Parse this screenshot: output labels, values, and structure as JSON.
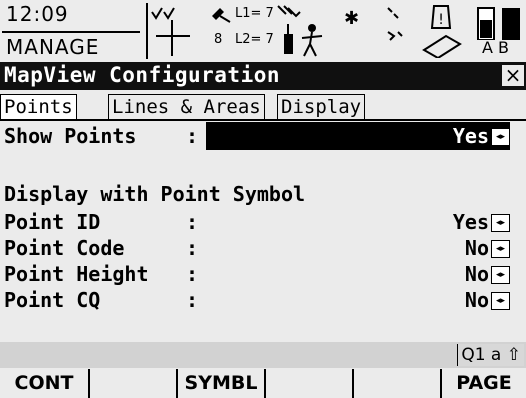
{
  "status": {
    "time": "12:09",
    "mode": "MANAGE",
    "l1_label": "L1= 7",
    "l2_label": "L2= 7",
    "sat_count": "8",
    "ab_label": "A B"
  },
  "window": {
    "title": "MapView Configuration",
    "close_glyph": "×"
  },
  "tabs": [
    {
      "label": "Points",
      "active": true
    },
    {
      "label": "Lines & Areas",
      "active": false
    },
    {
      "label": "Display",
      "active": false
    }
  ],
  "form": {
    "show_points": {
      "label": "Show Points",
      "colon": ":",
      "value": "Yes"
    },
    "section_heading": "Display with Point Symbol",
    "fields": [
      {
        "label": "Point ID",
        "colon": ":",
        "value": "Yes"
      },
      {
        "label": "Point Code",
        "colon": ":",
        "value": "No"
      },
      {
        "label": "Point Height",
        "colon": ":",
        "value": "No"
      },
      {
        "label": "Point CQ",
        "colon": ":",
        "value": "No"
      }
    ],
    "spinner_glyph": "◂▸"
  },
  "info": {
    "quick_code": "Q1 a ⇧"
  },
  "fkeys": [
    {
      "label": "CONT"
    },
    {
      "label": ""
    },
    {
      "label": "SYMBL"
    },
    {
      "label": ""
    },
    {
      "label": ""
    },
    {
      "label": "PAGE"
    }
  ]
}
